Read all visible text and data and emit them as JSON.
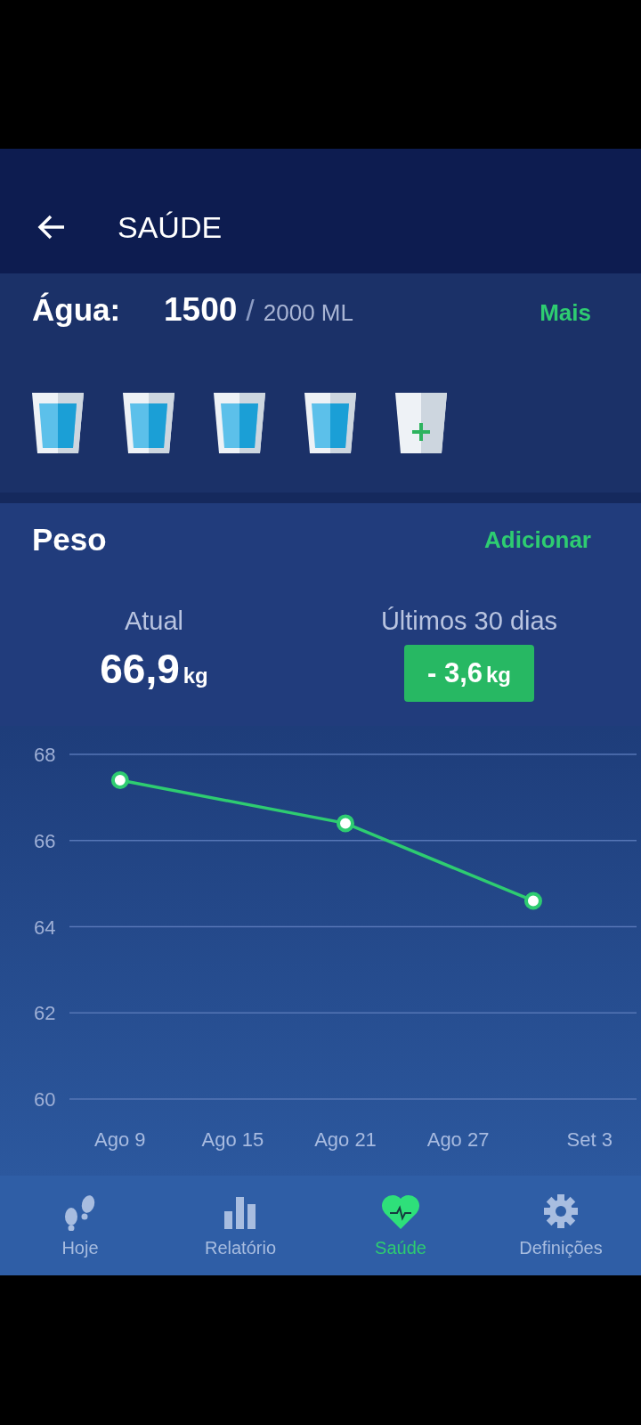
{
  "header": {
    "title": "SAÚDE"
  },
  "water": {
    "label": "Água:",
    "amount": "1500",
    "separator": "/",
    "goal": "2000 ML",
    "action": "Mais",
    "cups": [
      {
        "filled": true
      },
      {
        "filled": true
      },
      {
        "filled": true
      },
      {
        "filled": true
      },
      {
        "filled": false
      }
    ]
  },
  "weight": {
    "title": "Peso",
    "action": "Adicionar",
    "current": {
      "label": "Atual",
      "value": "66,9",
      "unit": "kg"
    },
    "change": {
      "label": "Últimos 30 dias",
      "value": "- 3,6",
      "unit": "kg"
    },
    "chart_data": {
      "type": "line",
      "ylim": [
        60,
        68
      ],
      "grid": true,
      "categories": [
        "Ago 9",
        null,
        null,
        null,
        null,
        null,
        "Ago 15",
        null,
        null,
        null,
        null,
        null,
        "Ago 21",
        null,
        null,
        null,
        null,
        null,
        "Ago 27",
        null,
        null,
        null,
        null,
        null,
        null,
        "Set 3"
      ],
      "yticks": [
        60,
        62,
        64,
        66,
        68
      ],
      "series": [
        {
          "color": "#2ecc71",
          "marker": "circle",
          "values": [
            67.4,
            null,
            null,
            null,
            null,
            null,
            null,
            null,
            null,
            null,
            null,
            null,
            66.4,
            null,
            null,
            null,
            null,
            null,
            null,
            null,
            null,
            null,
            64.6,
            null,
            null,
            null
          ]
        }
      ]
    }
  },
  "nav": [
    {
      "label": "Hoje",
      "selected": false
    },
    {
      "label": "Relatório",
      "selected": false
    },
    {
      "label": "Saúde",
      "selected": true
    },
    {
      "label": "Definições",
      "selected": false
    }
  ]
}
